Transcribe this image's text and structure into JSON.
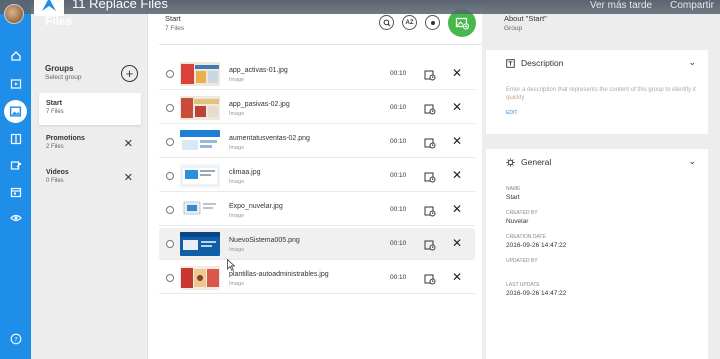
{
  "video_overlay": {
    "title": "11 Replace Files",
    "watch_later": "Ver más tarde",
    "share": "Compartir"
  },
  "rail": {
    "icons": [
      "dashboard-icon",
      "presentation-icon",
      "media-icon",
      "layout-icon",
      "playlist-icon",
      "schedule-icon",
      "preview-icon",
      "help-icon"
    ],
    "active": "media-icon"
  },
  "groups_panel": {
    "header": "Files",
    "title": "Groups",
    "subtitle": "Select group",
    "items": [
      {
        "name": "Start",
        "count": "7 Files",
        "active": true
      },
      {
        "name": "Promotions",
        "count": "2 Files",
        "active": false
      },
      {
        "name": "Videos",
        "count": "0 Files",
        "active": false
      }
    ]
  },
  "files_panel": {
    "title": "Start",
    "subtitle": "7 Files",
    "sort_label": "AZ",
    "files": [
      {
        "name": "app_activas-01.jpg",
        "type": "Image",
        "duration": "00:10"
      },
      {
        "name": "app_pasivas-02.jpg",
        "type": "Image",
        "duration": "00:10"
      },
      {
        "name": "aumentatusventas-02.png",
        "type": "Image",
        "duration": "00:10"
      },
      {
        "name": "climaa.jpg",
        "type": "Image",
        "duration": "00:10"
      },
      {
        "name": "Expo_nuvelar.jpg",
        "type": "Image",
        "duration": "00:10"
      },
      {
        "name": "NuevoSistema005.png",
        "type": "Image",
        "duration": "00:10"
      },
      {
        "name": "plantillas-autoadministrables.jpg",
        "type": "Image",
        "duration": "00:10"
      }
    ]
  },
  "details_panel": {
    "title": "About \"Start\"",
    "subtitle": "Group",
    "description": {
      "heading": "Description",
      "placeholder": "Enter a description that represents the content of this group to identify it quickly",
      "edit": "EDIT"
    },
    "general": {
      "heading": "General",
      "fields": [
        {
          "label": "NAME",
          "value": "Start"
        },
        {
          "label": "CREATED BY",
          "value": "Nuvelar"
        },
        {
          "label": "CREATION DATE",
          "value": "2016-09-26 14:47:22"
        },
        {
          "label": "UPDATED BY",
          "value": ""
        },
        {
          "label": "LAST UPDATE",
          "value": "2016-09-26 14:47:22"
        }
      ]
    }
  },
  "colors": {
    "rail_blue": "#1e8ee8",
    "add_green": "#49b84a",
    "link_blue": "#2d8ee0"
  }
}
